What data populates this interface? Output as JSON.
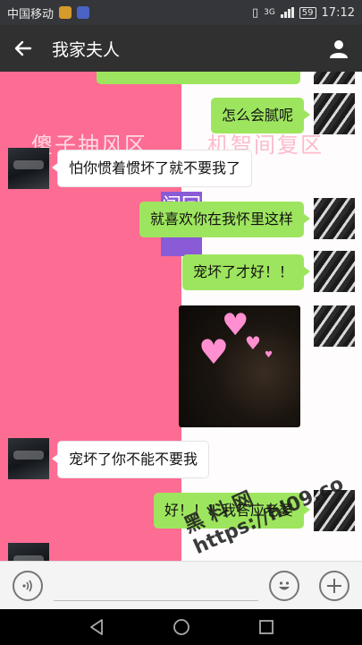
{
  "status_bar": {
    "carrier": "中国移动",
    "network": "3G",
    "battery": "59",
    "time": "17:12"
  },
  "header": {
    "title": "我家夫人",
    "back_icon": "arrow-left-icon",
    "profile_icon": "person-icon"
  },
  "background": {
    "left_text": "傻子抽风区",
    "right_text": "机智间复区",
    "purple_text": "闯回"
  },
  "messages": [
    {
      "id": "m1",
      "direction": "out",
      "text": ""
    },
    {
      "id": "m2",
      "direction": "out",
      "text": "怎么会腻呢"
    },
    {
      "id": "m3",
      "direction": "in",
      "text": "怕你惯着惯坏了就不要我了"
    },
    {
      "id": "m4",
      "direction": "out",
      "text": "就喜欢你在我怀里这样"
    },
    {
      "id": "m5",
      "direction": "out",
      "text": "宠坏了才好！！"
    },
    {
      "id": "m6",
      "direction": "out",
      "type": "image"
    },
    {
      "id": "m7",
      "direction": "in",
      "text": "宠坏了你不能不要我"
    },
    {
      "id": "m8",
      "direction": "out",
      "text": "好！！！我答应老婆"
    }
  ],
  "watermark": {
    "line1": "黑 料 网",
    "line2": "https://hl09.co"
  },
  "input_bar": {
    "voice_icon": "voice-icon",
    "emoji_icon": "emoji-icon",
    "plus_icon": "plus-icon"
  },
  "colors": {
    "out_bubble": "#9ee55f",
    "pink_bg": "#fd6c93",
    "top_bar": "#303030"
  }
}
